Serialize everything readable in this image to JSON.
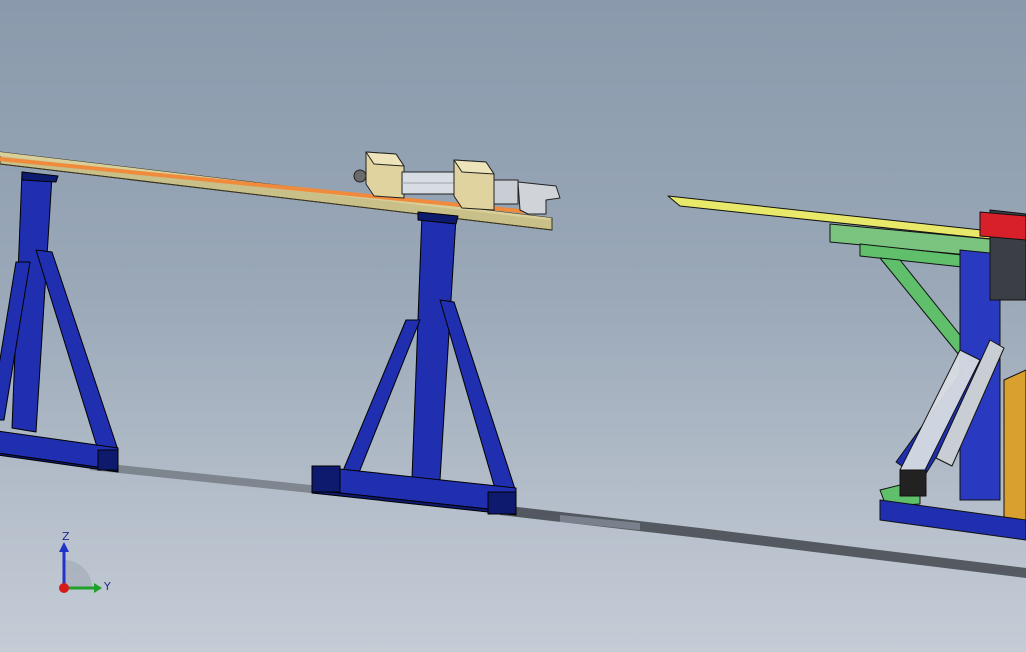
{
  "viewport": {
    "background_top": "#8a9aac",
    "background_bottom": "#c5ccd6"
  },
  "model": {
    "colors": {
      "stand": "#1f2fb0",
      "stand_dark": "#0e1a6e",
      "rail_top": "#d9cf9a",
      "rail_stripe": "#f08a3c",
      "block": "#e0d3a0",
      "cylinder": "#d8dde3",
      "yellow_plate": "#e8e86a",
      "green_frame": "#5fbf6a",
      "red_part": "#d8202a",
      "orange_panel": "#d9a030"
    }
  },
  "triad": {
    "z_label": "Z",
    "y_label": "Y",
    "z_color": "#2233cc",
    "y_color": "#1fa02a",
    "origin_color": "#d81a1a"
  }
}
